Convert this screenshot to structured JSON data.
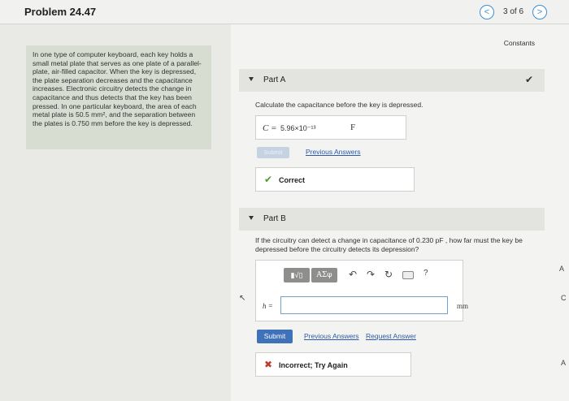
{
  "header": {
    "title": "Problem 24.47",
    "page_count": "3 of 6",
    "prev_symbol": "<",
    "next_symbol": ">"
  },
  "constants_link": "Constants",
  "problem_text": "In one type of computer keyboard, each key holds a small metal plate that serves as one plate of a parallel-plate, air-filled capacitor. When the key is depressed, the plate separation decreases and the capacitance increases. Electronic circuitry detects the change in capacitance and thus detects that the key has been pressed. In one particular keyboard, the area of each metal plate is 50.5 mm², and the separation between the plates is 0.750 mm before the key is depressed.",
  "part_a": {
    "label": "Part A",
    "question": "Calculate the capacitance before the key is depressed.",
    "variable": "C =",
    "answer": "5.96×10⁻¹³",
    "unit": "F",
    "submit_label": "Submit",
    "previous_answers": "Previous Answers",
    "feedback": "Correct"
  },
  "part_b": {
    "label": "Part B",
    "question": "If the circuitry can detect a change in capacitance of 0.230 pF , how far must the key be depressed before the circuitry detects its depression?",
    "toolbar": {
      "templates": "▮√▯",
      "greek": "ΑΣφ",
      "undo": "↶",
      "redo": "↷",
      "reset": "↻",
      "help": "?"
    },
    "variable": "h =",
    "input_value": "",
    "unit": "mm",
    "submit_label": "Submit",
    "previous_answers": "Previous Answers",
    "request_answer": "Request Answer",
    "feedback": "Incorrect; Try Again"
  },
  "icons": {
    "check": "✔",
    "x": "✖",
    "cursor": "↖"
  },
  "edge_letters": [
    "A",
    "C",
    "A"
  ]
}
